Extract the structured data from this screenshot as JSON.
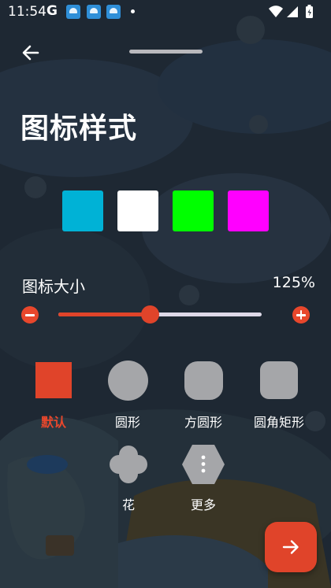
{
  "status_bar": {
    "time": "11:54",
    "g_letter": "G",
    "icons": [
      "google-g-icon",
      "app-notification-icon",
      "app-notification-icon",
      "app-notification-icon",
      "dot-icon",
      "wifi-icon",
      "signal-icon",
      "battery-charging-icon"
    ]
  },
  "header": {
    "back_icon": "arrow-left-icon",
    "handle_icon": "drag-handle-icon"
  },
  "page": {
    "title": "图标样式"
  },
  "colors": {
    "accent": "#e0442a",
    "swatches": [
      "#00b2d6",
      "#ffffff",
      "#00ff00",
      "#ff00ff"
    ]
  },
  "size": {
    "label": "图标大小",
    "value_text": "125%",
    "slider_fraction": 0.45,
    "decrease_icon": "minus-circle-icon",
    "increase_icon": "plus-circle-icon"
  },
  "shapes": [
    {
      "label": "默认",
      "selected": true
    },
    {
      "label": "圆形",
      "selected": false
    },
    {
      "label": "方圆形",
      "selected": false
    },
    {
      "label": "圆角矩形",
      "selected": false
    },
    {
      "label": "花",
      "selected": false
    },
    {
      "label": "更多",
      "selected": false,
      "icon": "more-vertical-icon"
    }
  ],
  "next_button": {
    "icon": "arrow-right-icon"
  }
}
